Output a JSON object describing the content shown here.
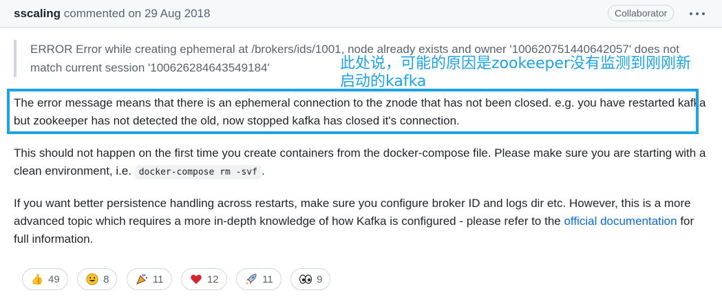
{
  "header": {
    "author": "sscaling",
    "meta": "commented on 29 Aug 2018",
    "badge": "Collaborator"
  },
  "quote": {
    "text": "ERROR Error while creating ephemeral at /brokers/ids/1001, node already exists and owner '100620751440642057' does not match current session '100626284643549184'"
  },
  "annotation": {
    "text": "此处说，可能的原因是zookeeper没有监测到刚刚新启动的kafka",
    "color": "#1aa3e8"
  },
  "body": {
    "p1": "The error message means that there is an ephemeral connection to the znode that has not been closed. e.g. you have restarted kafka but zookeeper has not detected the old, now stopped kafka has closed it's connection.",
    "p2_before": "This should not happen on the first time you create containers from the docker-compose file. Please make sure you are starting with a clean environment, i.e. ",
    "p2_code": "docker-compose rm -svf",
    "p2_after": ".",
    "p3_before": "If you want better persistence handling across restarts, make sure you configure broker ID and logs dir etc. However, this is a more advanced topic which requires a more in-depth knowledge of how Kafka is configured - please refer to the ",
    "p3_link": "official documentation",
    "p3_after": " for full information."
  },
  "reactions": [
    {
      "icon": "thumbs-up-icon",
      "glyph": "👍",
      "count": "49"
    },
    {
      "icon": "laugh-icon",
      "glyph": "😄",
      "count": "8"
    },
    {
      "icon": "hooray-icon",
      "glyph": "🎉",
      "count": "11"
    },
    {
      "icon": "heart-icon",
      "glyph": "❤",
      "count": "12"
    },
    {
      "icon": "rocket-icon",
      "glyph": "🚀",
      "count": "11"
    },
    {
      "icon": "eyes-icon",
      "glyph": "👀",
      "count": "9"
    }
  ]
}
